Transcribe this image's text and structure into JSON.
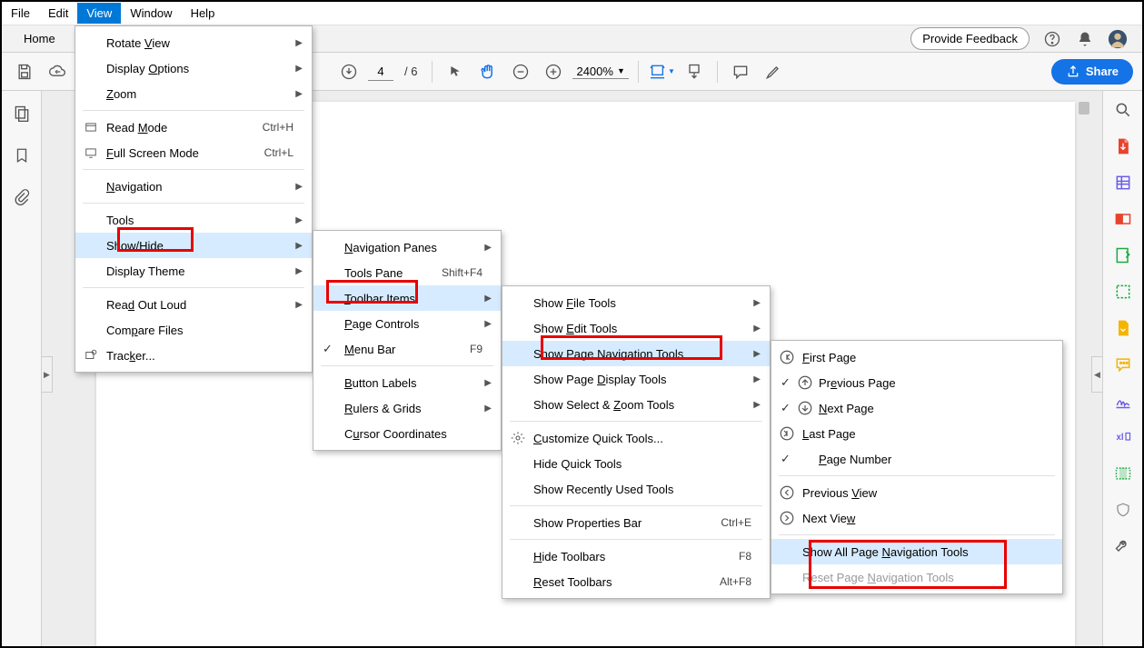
{
  "menubar": {
    "items": [
      "File",
      "Edit",
      "View",
      "Window",
      "Help"
    ],
    "active": 2
  },
  "tabs": {
    "home": "Home"
  },
  "header": {
    "feedback": "Provide Feedback"
  },
  "toolbar": {
    "page_current": "4",
    "page_total": "/ 6",
    "zoom": "2400%",
    "share": "Share"
  },
  "view_menu": {
    "rotate": "Rotate View",
    "display_options": "Display Options",
    "zoom": "Zoom",
    "read_mode": "Read Mode",
    "read_mode_sc": "Ctrl+H",
    "fullscreen": "Full Screen Mode",
    "fullscreen_sc": "Ctrl+L",
    "navigation": "Navigation",
    "tools": "Tools",
    "show_hide": "Show/Hide",
    "display_theme": "Display Theme",
    "read_out": "Read Out Loud",
    "compare": "Compare Files",
    "tracker": "Tracker..."
  },
  "show_hide_menu": {
    "nav_panes": "Navigation Panes",
    "tools_pane": "Tools Pane",
    "tools_pane_sc": "Shift+F4",
    "toolbar_items": "Toolbar Items",
    "page_controls": "Page Controls",
    "menu_bar": "Menu Bar",
    "menu_bar_sc": "F9",
    "button_labels": "Button Labels",
    "rulers": "Rulers & Grids",
    "cursor_coords": "Cursor Coordinates"
  },
  "toolbar_items_menu": {
    "file_tools": "Show File Tools",
    "edit_tools": "Show Edit Tools",
    "page_nav": "Show Page Navigation Tools",
    "page_display": "Show Page Display Tools",
    "select_zoom": "Show Select & Zoom Tools",
    "customize": "Customize Quick Tools...",
    "hide_quick": "Hide Quick Tools",
    "show_recent": "Show Recently Used Tools",
    "show_props": "Show Properties Bar",
    "show_props_sc": "Ctrl+E",
    "hide_toolbars": "Hide Toolbars",
    "hide_toolbars_sc": "F8",
    "reset_toolbars": "Reset Toolbars",
    "reset_toolbars_sc": "Alt+F8"
  },
  "page_nav_menu": {
    "first": "First Page",
    "prev": "Previous Page",
    "next": "Next Page",
    "last": "Last Page",
    "page_num": "Page Number",
    "prev_view": "Previous View",
    "next_view": "Next View",
    "show_all": "Show All Page Navigation Tools",
    "reset": "Reset Page Navigation Tools"
  }
}
